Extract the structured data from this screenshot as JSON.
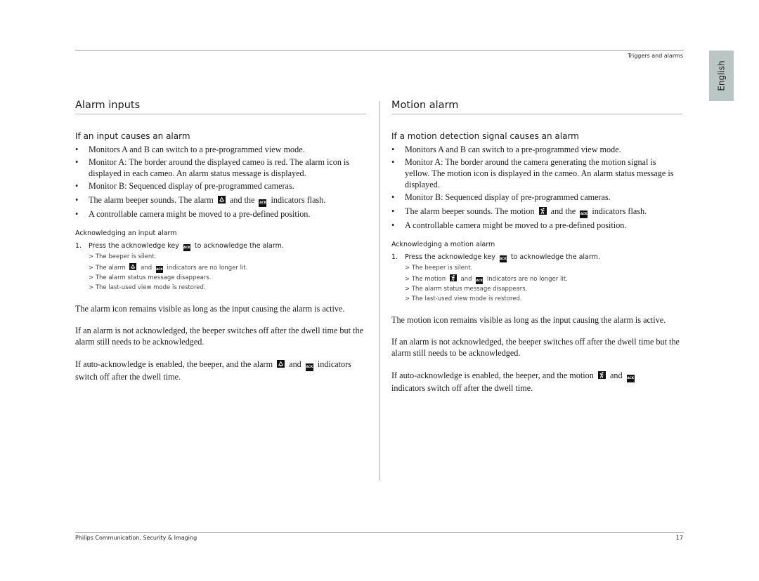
{
  "header": {
    "section_label": "Triggers and alarms",
    "language_tab": "English"
  },
  "icons": {
    "ack": "ACK",
    "alarm": "alarm-bell-icon",
    "motion": "motion-person-icon"
  },
  "left": {
    "title": "Alarm inputs",
    "subtitle": "If an input causes an alarm",
    "bullets": [
      "Monitors A and B can switch to a pre-programmed view mode.",
      "Monitor A: The border around the displayed cameo is red. The alarm icon is displayed in each cameo. An alarm status message is displayed.",
      "Monitor B: Sequenced display of pre-programmed cameras.",
      {
        "pre": "The alarm beeper sounds. The alarm",
        "mid": "and the",
        "post": "indicators flash."
      },
      "A controllable camera might be moved to a pre-defined position."
    ],
    "ack_heading": "Acknowledging an input alarm",
    "step": {
      "num": "1.",
      "pre": "Press the acknowledge key",
      "post": "to acknowledge the alarm."
    },
    "results": [
      "> The beeper is silent.",
      {
        "pre": "> The alarm",
        "mid": "and",
        "post": "indicators are no longer lit."
      },
      "> The alarm status message disappears.",
      "> The last-used view mode is restored."
    ],
    "para1": "The alarm icon remains visible as long as the input causing the alarm is active.",
    "para2": "If an alarm is not acknowledged, the beeper switches off after the dwell time but the alarm still needs to be acknowledged.",
    "para3": {
      "pre": "If auto-acknowledge is enabled, the beeper, and the alarm",
      "mid": "and",
      "post": "indicators switch off after the dwell time."
    }
  },
  "right": {
    "title": "Motion alarm",
    "subtitle": "If a motion detection signal causes an alarm",
    "bullets": [
      "Monitors A and B can switch to a pre-programmed view mode.",
      "Monitor A: The border around the camera generating the motion signal is yellow. The motion icon is displayed in the cameo. An alarm status message is displayed.",
      "Monitor B: Sequenced display of pre-programmed cameras.",
      {
        "pre": "The alarm beeper sounds. The motion",
        "mid": "and the",
        "post": "indicators flash."
      },
      "A controllable camera might be moved to a pre-defined position."
    ],
    "ack_heading": "Acknowledging a motion alarm",
    "step": {
      "num": "1.",
      "pre": "Press the acknowledge key",
      "post": "to acknowledge the alarm."
    },
    "results": [
      "> The beeper is silent.",
      {
        "pre": "> The motion",
        "mid": "and",
        "post": "indicators are no longer lit."
      },
      "> The alarm status message disappears.",
      "> The last-used view mode is restored."
    ],
    "para1": "The motion icon remains visible as long as the input causing the alarm is active.",
    "para2": "If an alarm is not acknowledged, the beeper switches off after the dwell time but the alarm still needs to be acknowledged.",
    "para3": {
      "pre": "If auto-acknowledge is enabled, the beeper, and the motion",
      "mid": "and",
      "post": "indicators switch off after the dwell time."
    }
  },
  "footer": {
    "company": "Philips Communication, Security & Imaging",
    "page_number": "17"
  }
}
